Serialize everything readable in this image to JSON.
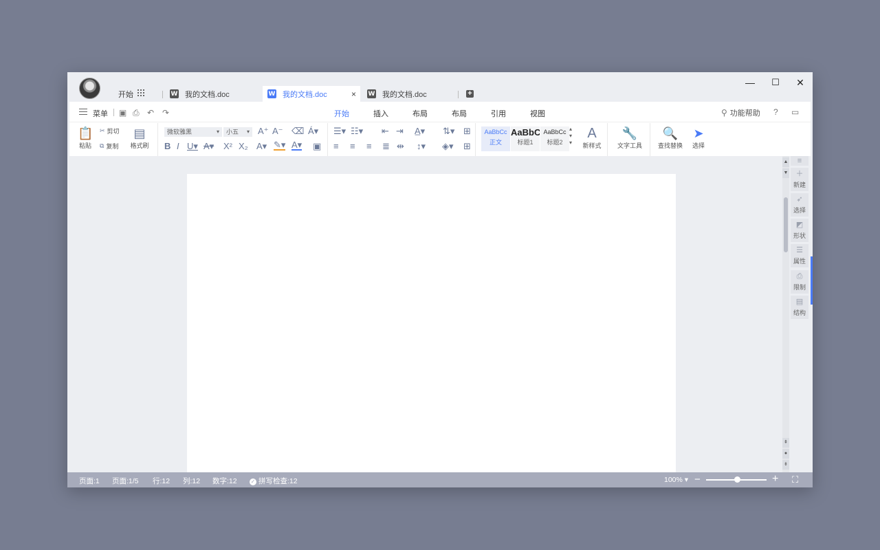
{
  "tabbar": {
    "home_label": "开始",
    "tabs": [
      {
        "label": "我的文档.doc",
        "icon": "W"
      },
      {
        "label": "我的文档.doc",
        "icon": "W"
      },
      {
        "label": "我的文档.doc",
        "icon": "W"
      }
    ],
    "close_glyph": "×",
    "new_tab_glyph": "+",
    "controls": {
      "minimize": "—",
      "maximize": "☐",
      "close": "✕"
    }
  },
  "menubar": {
    "menu_label": "菜单",
    "tabs": [
      "开始",
      "插入",
      "布局",
      "布局",
      "引用",
      "视图"
    ],
    "help_label": "功能帮助",
    "question": "?"
  },
  "toolbar": {
    "paste": "粘贴",
    "cut": "剪切",
    "copy": "复制",
    "format_painter": "格式刷",
    "font_name": "微软雅黑",
    "font_size": "小五",
    "styles": [
      {
        "sample": "AaBbCc",
        "label": "正文"
      },
      {
        "sample": "AaBbC",
        "label": "标题1"
      },
      {
        "sample": "AaBbCc",
        "label": "标题2"
      }
    ],
    "new_style": "新样式",
    "text_tools": "文字工具",
    "find_replace": "查找替换",
    "select": "选择"
  },
  "sidebar": {
    "items": [
      "新建",
      "选择",
      "形状",
      "属性",
      "限制",
      "结构"
    ]
  },
  "status": {
    "page": "页面:1",
    "pages": "页面:1/5",
    "row": "行:12",
    "col": "列:12",
    "words": "数字:12",
    "spell": "拼写检查:12",
    "zoom": "100%",
    "zoom_minus": "−",
    "zoom_plus": "+",
    "zoom_level": 0.5
  },
  "colors": {
    "accent": "#4a7bf7",
    "status_bar": "#a7abbb",
    "background": "#777d91"
  }
}
